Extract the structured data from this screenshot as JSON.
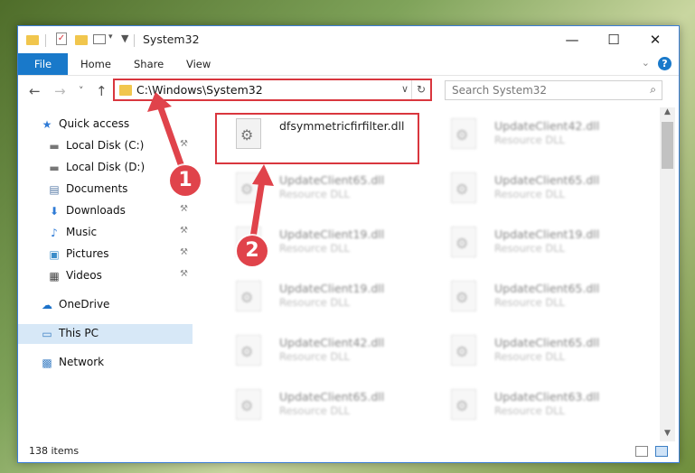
{
  "window": {
    "title": "System32",
    "controls": {
      "minimize": "—",
      "maximize": "☐",
      "close": "✕"
    }
  },
  "ribbon": {
    "tabs": [
      "File",
      "Home",
      "Share",
      "View"
    ],
    "expand_glyph": "⌄",
    "help_glyph": "?"
  },
  "nav": {
    "back": "←",
    "forward": "→",
    "recent": "˅",
    "up": "↑"
  },
  "address": {
    "path": "C:\\Windows\\System32",
    "dropdown_glyph": "∨",
    "refresh_glyph": "↻"
  },
  "search": {
    "placeholder": "Search System32",
    "icon_glyph": "⌕"
  },
  "sidebar": {
    "items": [
      {
        "label": "Quick access",
        "icon": "star-icon",
        "glyph": "★",
        "pinned": false
      },
      {
        "label": "Local Disk (C:)",
        "icon": "drive-icon",
        "glyph": "▬",
        "pinned": true
      },
      {
        "label": "Local Disk (D:)",
        "icon": "drive-icon",
        "glyph": "▬",
        "pinned": true
      },
      {
        "label": "Documents",
        "icon": "document-icon",
        "glyph": "▤",
        "pinned": true
      },
      {
        "label": "Downloads",
        "icon": "download-icon",
        "glyph": "⬇",
        "pinned": true
      },
      {
        "label": "Music",
        "icon": "music-icon",
        "glyph": "♪",
        "pinned": true
      },
      {
        "label": "Pictures",
        "icon": "pictures-icon",
        "glyph": "▣",
        "pinned": true
      },
      {
        "label": "Videos",
        "icon": "video-icon",
        "glyph": "▦",
        "pinned": true
      },
      {
        "label": "OneDrive",
        "icon": "cloud-icon",
        "glyph": "☁",
        "pinned": false
      },
      {
        "label": "This PC",
        "icon": "computer-icon",
        "glyph": "▭",
        "pinned": false
      },
      {
        "label": "Network",
        "icon": "network-icon",
        "glyph": "▩",
        "pinned": false
      }
    ],
    "pin_glyph": "⚒"
  },
  "files": {
    "highlighted": {
      "name": "dfsymmetricfirfilter.dll"
    },
    "column1": [
      {
        "name": "UpdateClient65.dll",
        "type": "Resource DLL"
      },
      {
        "name": "UpdateClient19.dll",
        "type": "Resource DLL"
      },
      {
        "name": "UpdateClient19.dll",
        "type": "Resource DLL"
      },
      {
        "name": "UpdateClient42.dll",
        "type": "Resource DLL"
      },
      {
        "name": "UpdateClient65.dll",
        "type": "Resource DLL"
      }
    ],
    "column2": [
      {
        "name": "UpdateClient42.dll",
        "type": "Resource DLL"
      },
      {
        "name": "UpdateClient65.dll",
        "type": "Resource DLL"
      },
      {
        "name": "UpdateClient19.dll",
        "type": "Resource DLL"
      },
      {
        "name": "UpdateClient65.dll",
        "type": "Resource DLL"
      },
      {
        "name": "UpdateClient65.dll",
        "type": "Resource DLL"
      },
      {
        "name": "UpdateClient63.dll",
        "type": "Resource DLL"
      }
    ]
  },
  "status": {
    "item_count": "138 items"
  },
  "annotations": {
    "step1": "1",
    "step2": "2",
    "color": "#e0434b"
  }
}
